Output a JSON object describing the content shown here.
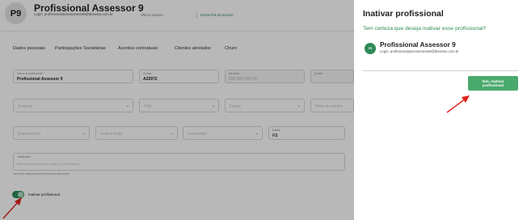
{
  "header": {
    "avatar_initials": "P9",
    "name": "Profissional Assessor 9",
    "login": "Login: profissionalassessorteste9@dissewo.com.br",
    "last_access": "Último acesso: -",
    "send_link": "Enviar link de acesso"
  },
  "tabs": [
    "Dados pessoais",
    "Participações Societárias",
    "Acordos contratuais",
    "Clientes atrelados",
    "Churn"
  ],
  "form": {
    "row1": [
      {
        "label": "Nome do profissional*",
        "value": "Profissional Assessor 9"
      },
      {
        "label": "Código",
        "value": "A22972"
      },
      {
        "label": "Info adic.",
        "value": "000.000.000-00"
      },
      {
        "label": "E-mail",
        "value": ""
      }
    ],
    "row2": [
      "Empresa",
      "Filial",
      "Equipe",
      "Plano de carreira"
    ],
    "row3": [
      "Departamento",
      "Segmentação",
      "Senioridade"
    ],
    "salary": {
      "label": "Salário",
      "value": "R$"
    },
    "obs_label": "Justificativa",
    "obs_placeholder": "Descreva observações sobre o profissional...",
    "hint": "Use este campo para informações adicionais",
    "toggle_label": "Inativar profissional",
    "toggle_on": true
  },
  "panel": {
    "title": "Inativar profissional",
    "question": "Tem certeza que deseja inativar esse profissional?",
    "avatar_initials": "P9",
    "name": "Profissional Assessor 9",
    "login": "Login: profissionalassessorteste9@dissewo.com.br",
    "confirm_label": "Sim, inativar profissional"
  },
  "colors": {
    "accent": "#2e8b57",
    "button": "#4aa96c",
    "arrow": "#e0201c",
    "overlay": "rgba(0,0,0,0.28)"
  }
}
